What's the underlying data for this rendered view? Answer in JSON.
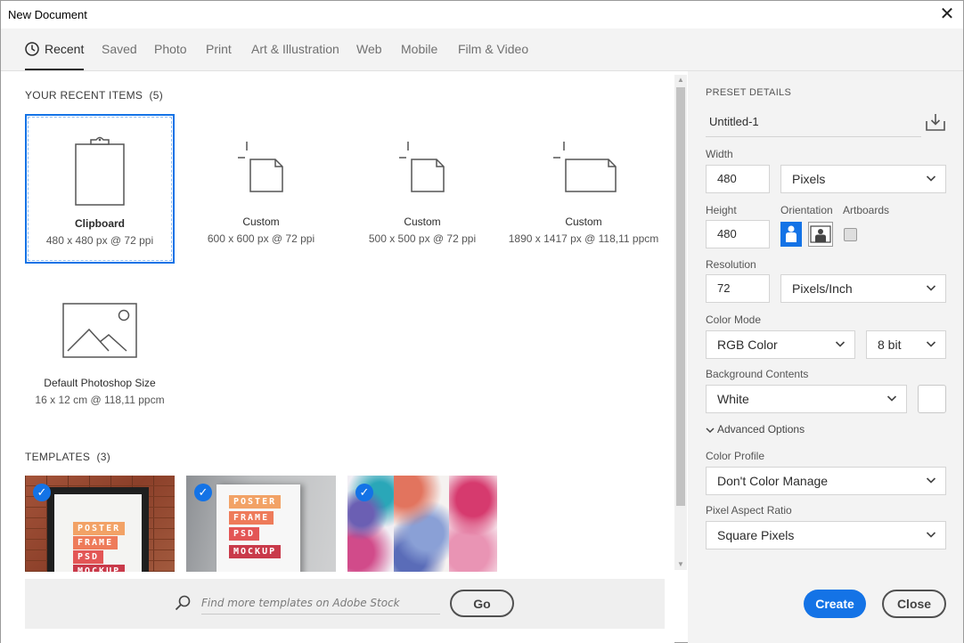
{
  "window": {
    "title": "New Document"
  },
  "tabs": [
    {
      "label": "Recent"
    },
    {
      "label": "Saved"
    },
    {
      "label": "Photo"
    },
    {
      "label": "Print"
    },
    {
      "label": "Art & Illustration"
    },
    {
      "label": "Web"
    },
    {
      "label": "Mobile"
    },
    {
      "label": "Film & Video"
    }
  ],
  "recent": {
    "heading": "YOUR RECENT ITEMS",
    "count": "(5)",
    "items": [
      {
        "name": "Clipboard",
        "dims": "480 x 480 px @ 72 ppi",
        "icon": "clipboard-icon"
      },
      {
        "name": "Custom",
        "dims": "600 x 600 px @ 72 ppi",
        "icon": "custom-document-icon"
      },
      {
        "name": "Custom",
        "dims": "500 x 500 px @ 72 ppi",
        "icon": "custom-document-icon"
      },
      {
        "name": "Custom",
        "dims": "1890 x 1417 px @ 118,11 ppcm",
        "icon": "custom-document-landscape-icon"
      },
      {
        "name": "Default Photoshop Size",
        "dims": "16 x 12 cm @ 118,11 ppcm",
        "icon": "image-placeholder-icon"
      }
    ]
  },
  "templates": {
    "heading": "TEMPLATES",
    "count": "(3)",
    "poster_words": [
      "POSTER",
      "FRAME",
      "PSD",
      "MOCKUP"
    ]
  },
  "search": {
    "placeholder": "Find more templates on Adobe Stock",
    "go_label": "Go"
  },
  "preset": {
    "section_title": "PRESET DETAILS",
    "name": "Untitled-1",
    "width_label": "Width",
    "width_value": "480",
    "width_unit": "Pixels",
    "height_label": "Height",
    "height_value": "480",
    "orientation_label": "Orientation",
    "artboards_label": "Artboards",
    "resolution_label": "Resolution",
    "resolution_value": "72",
    "resolution_unit": "Pixels/Inch",
    "color_mode_label": "Color Mode",
    "color_mode_value": "RGB Color",
    "bit_depth_value": "8 bit",
    "background_label": "Background Contents",
    "background_value": "White",
    "advanced_label": "Advanced Options",
    "color_profile_label": "Color Profile",
    "color_profile_value": "Don't Color Manage",
    "pixel_aspect_label": "Pixel Aspect Ratio",
    "pixel_aspect_value": "Square Pixels"
  },
  "buttons": {
    "create": "Create",
    "close": "Close"
  },
  "colors": {
    "accent": "#1473e6",
    "panel": "#f3f3f3"
  }
}
